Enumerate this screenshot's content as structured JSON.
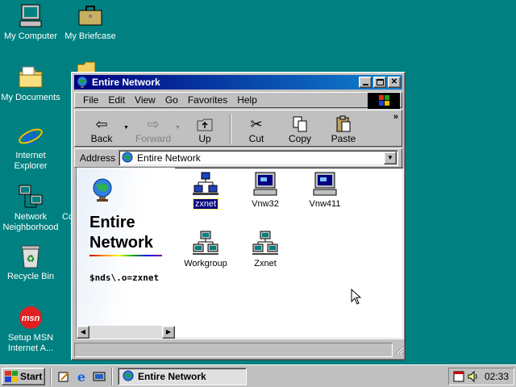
{
  "desktop": {
    "icons": [
      {
        "label": "My Computer"
      },
      {
        "label": "My Briefcase"
      },
      {
        "label": "My Documents"
      },
      {
        "label": "Internet Explorer"
      },
      {
        "label": "Network Neighborhood"
      },
      {
        "label": "Recycle Bin"
      },
      {
        "label": "Setup MSN Internet A..."
      }
    ],
    "partial_label": "Co"
  },
  "window": {
    "title": "Entire Network",
    "menu": [
      "File",
      "Edit",
      "View",
      "Go",
      "Favorites",
      "Help"
    ],
    "toolbar": {
      "back": "Back",
      "forward": "Forward",
      "up": "Up",
      "cut": "Cut",
      "copy": "Copy",
      "paste": "Paste",
      "more": "»"
    },
    "address": {
      "label": "Address",
      "value": "Entire Network"
    },
    "left_pane": {
      "title_line1": "Entire",
      "title_line2": "Network",
      "path": "$nds\\.o=zxnet"
    },
    "items": [
      {
        "label": "zxnet",
        "selected": true
      },
      {
        "label": "Vnw32"
      },
      {
        "label": "Vnw411"
      },
      {
        "label": "Workgroup"
      },
      {
        "label": "Zxnet"
      }
    ]
  },
  "taskbar": {
    "start": "Start",
    "task": "Entire Network",
    "clock": "02:33"
  },
  "colors": {
    "desktop": "#008080",
    "titlebar": "#000080",
    "selection": "#000080"
  }
}
